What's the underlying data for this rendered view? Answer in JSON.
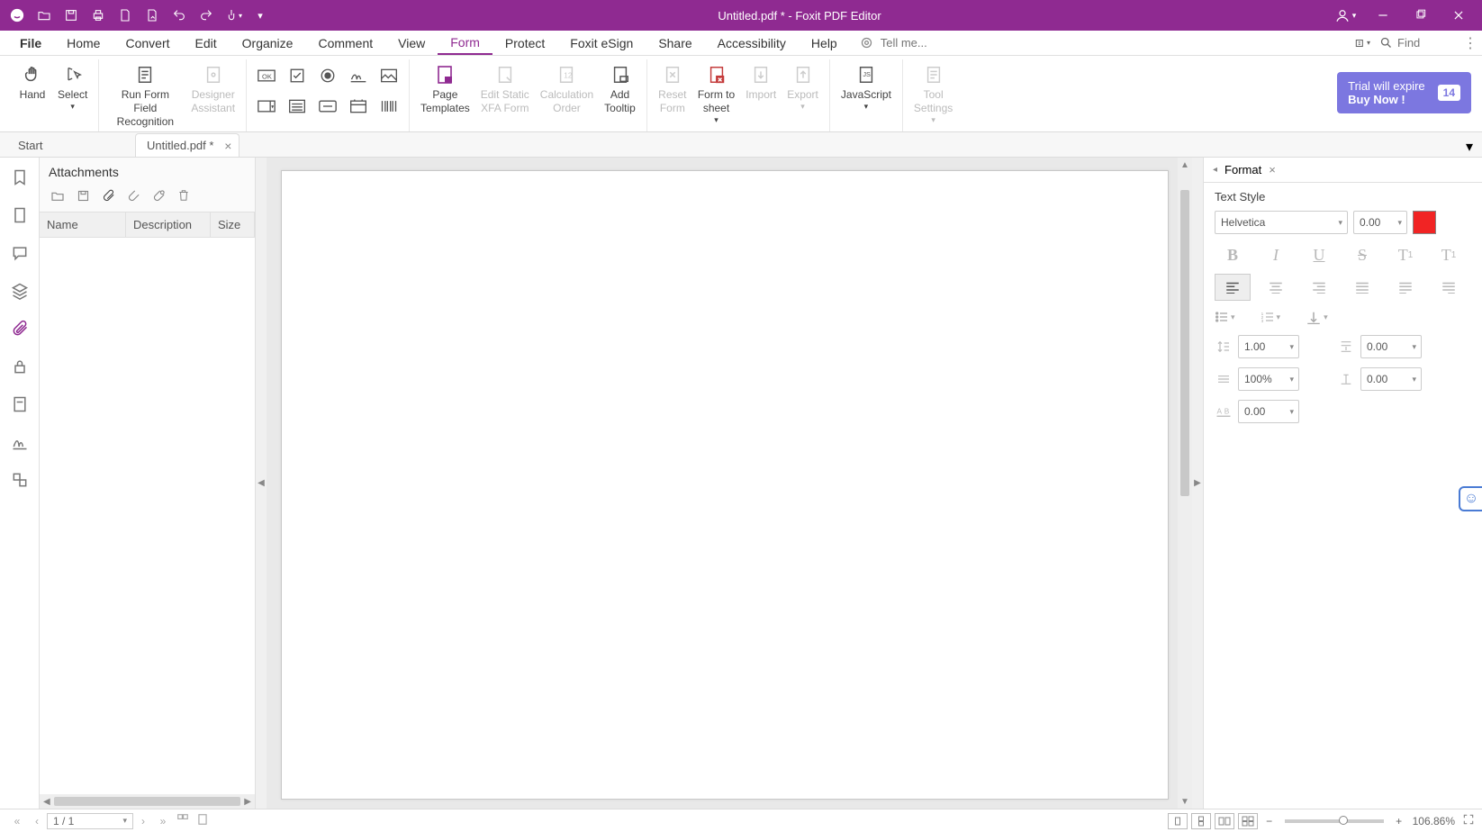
{
  "app": {
    "title": "Untitled.pdf * - Foxit PDF Editor"
  },
  "menu": {
    "items": [
      "File",
      "Home",
      "Convert",
      "Edit",
      "Organize",
      "Comment",
      "View",
      "Form",
      "Protect",
      "Foxit eSign",
      "Share",
      "Accessibility",
      "Help"
    ],
    "active_index": 7,
    "tell_me_placeholder": "Tell me...",
    "find_placeholder": "Find"
  },
  "ribbon": {
    "hand": "Hand",
    "select": "Select",
    "run_form": "Run Form Field\nRecognition",
    "designer": "Designer\nAssistant",
    "page_templates": "Page\nTemplates",
    "edit_xfa": "Edit Static\nXFA Form",
    "calc_order": "Calculation\nOrder",
    "add_tooltip": "Add\nTooltip",
    "reset_form": "Reset\nForm",
    "form_to_sheet": "Form to\nsheet",
    "import": "Import",
    "export": "Export",
    "javascript": "JavaScript",
    "tool_settings": "Tool\nSettings"
  },
  "trial": {
    "line1": "Trial will expire",
    "line2": "Buy Now !",
    "days": "14"
  },
  "tabs": {
    "start": "Start",
    "doc": "Untitled.pdf *"
  },
  "attachments": {
    "title": "Attachments",
    "headers": {
      "name": "Name",
      "description": "Description",
      "size": "Size"
    }
  },
  "format_panel": {
    "tab": "Format",
    "section": "Text Style",
    "font": "Helvetica",
    "font_size": "0.00",
    "line_spacing": "1.00",
    "para_spacing": "0.00",
    "hscale": "100%",
    "baseline": "0.00",
    "char_spacing": "0.00",
    "color": "#f12424"
  },
  "status": {
    "page": "1 / 1",
    "zoom": "106.86%"
  }
}
